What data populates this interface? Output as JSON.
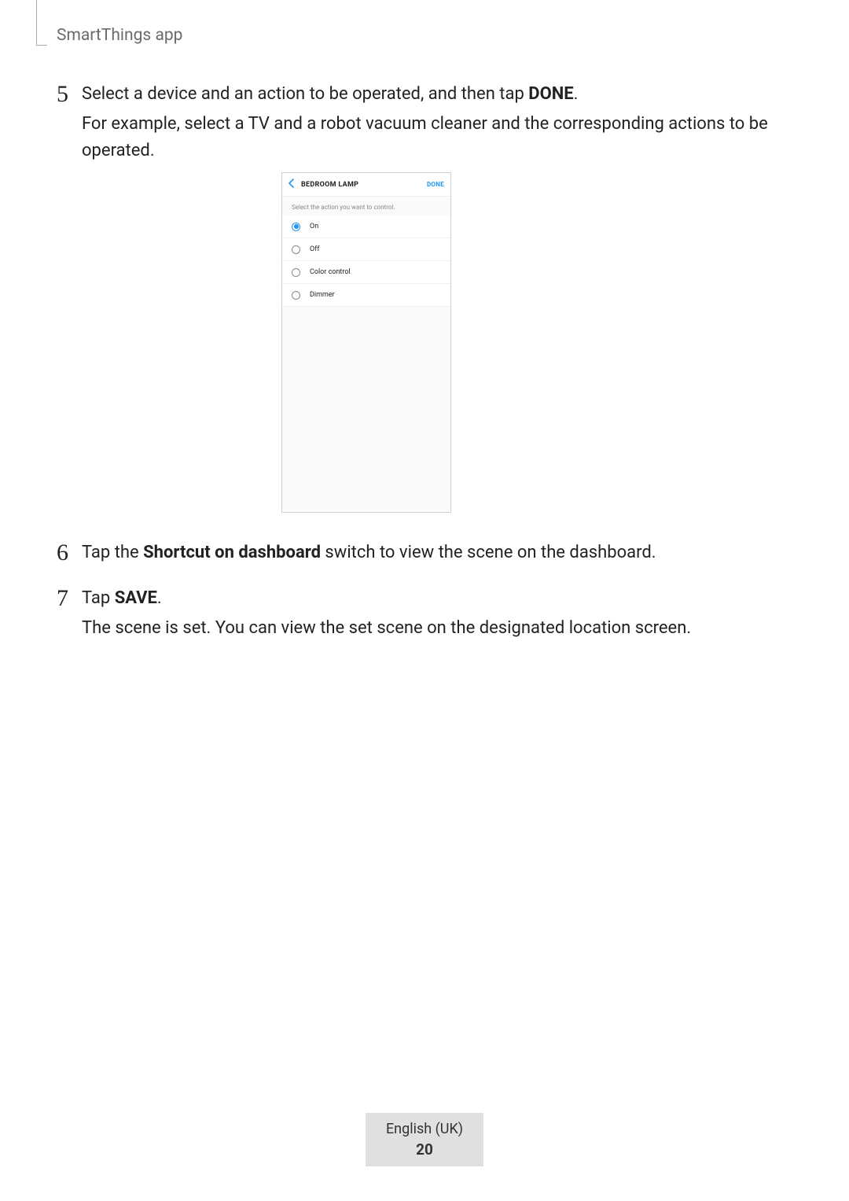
{
  "header": {
    "title": "SmartThings app"
  },
  "steps": {
    "step5": {
      "number": "5",
      "line1_pre": "Select a device and an action to be operated, and then tap ",
      "line1_bold": "DONE",
      "line1_post": ".",
      "line2": "For example, select a TV and a robot vacuum cleaner and the corresponding actions to be operated."
    },
    "step6": {
      "number": "6",
      "text_pre": "Tap the ",
      "text_bold": "Shortcut on dashboard",
      "text_post": " switch to view the scene on the dashboard."
    },
    "step7": {
      "number": "7",
      "text_pre": "Tap ",
      "text_bold": "SAVE",
      "text_post": ".",
      "line2": "The scene is set. You can view the set scene on the designated location screen."
    }
  },
  "screenshot": {
    "title": "BEDROOM LAMP",
    "done": "DONE",
    "subheader": "Select the action you want to control.",
    "options": {
      "opt0": {
        "label": "On",
        "selected": true
      },
      "opt1": {
        "label": "Off",
        "selected": false
      },
      "opt2": {
        "label": "Color control",
        "selected": false
      },
      "opt3": {
        "label": "Dimmer",
        "selected": false
      }
    }
  },
  "footer": {
    "lang": "English (UK)",
    "page": "20"
  }
}
